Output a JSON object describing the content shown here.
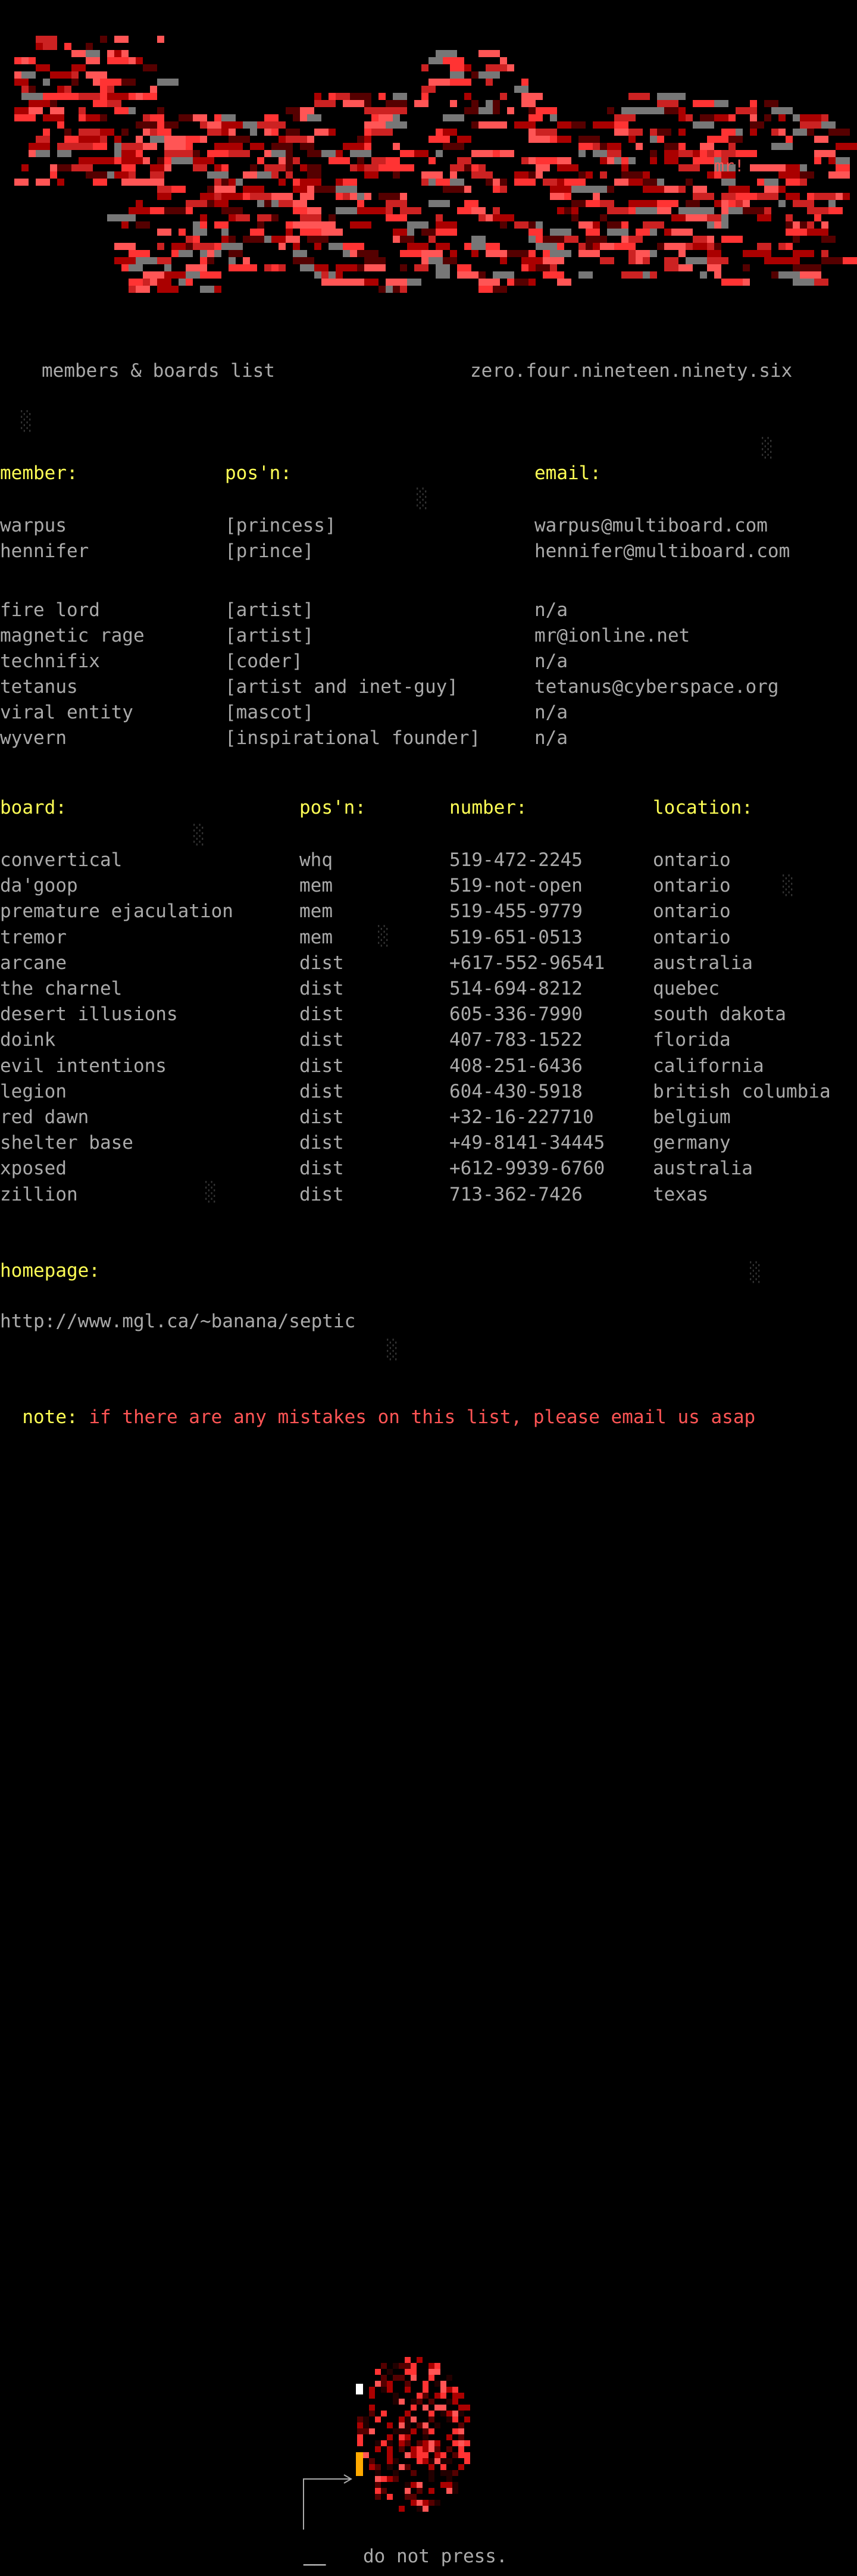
{
  "header": {
    "logo_tag": "mr!",
    "subtitle_left": "members & boards list",
    "subtitle_right": "zero.four.nineteen.ninety.six"
  },
  "members": {
    "headers": {
      "member": "member:",
      "pos": "pos'n:",
      "email": "email:"
    },
    "rows": [
      {
        "member": "warpus",
        "pos": "[princess]",
        "email": "warpus@multiboard.com"
      },
      {
        "member": "hennifer",
        "pos": "[prince]",
        "email": "hennifer@multiboard.com"
      },
      {
        "member": "fire lord",
        "pos": "[artist]",
        "email": "n/a"
      },
      {
        "member": "magnetic rage",
        "pos": "[artist]",
        "email": "mr@ionline.net"
      },
      {
        "member": "technifix",
        "pos": "[coder]",
        "email": "n/a"
      },
      {
        "member": "tetanus",
        "pos": "[artist and inet-guy]",
        "email": "tetanus@cyberspace.org"
      },
      {
        "member": "viral entity",
        "pos": "[mascot]",
        "email": "n/a"
      },
      {
        "member": "wyvern",
        "pos": "[inspirational founder]",
        "email": "n/a"
      }
    ]
  },
  "boards": {
    "headers": {
      "board": "board:",
      "pos": "pos'n:",
      "number": "number:",
      "location": "location:"
    },
    "rows": [
      {
        "board": "convertical",
        "pos": "whq",
        "number": "519-472-2245",
        "location": "ontario"
      },
      {
        "board": "da'goop",
        "pos": "mem",
        "number": "519-not-open",
        "location": "ontario"
      },
      {
        "board": "premature ejaculation",
        "pos": "mem",
        "number": "519-455-9779",
        "location": "ontario"
      },
      {
        "board": "tremor",
        "pos": "mem",
        "number": "519-651-0513",
        "location": "ontario"
      },
      {
        "board": "arcane",
        "pos": "dist",
        "number": "+617-552-96541",
        "location": "australia"
      },
      {
        "board": "the charnel",
        "pos": "dist",
        "number": "514-694-8212",
        "location": "quebec"
      },
      {
        "board": "desert illusions",
        "pos": "dist",
        "number": "605-336-7990",
        "location": "south dakota"
      },
      {
        "board": "doink",
        "pos": "dist",
        "number": "407-783-1522",
        "location": "florida"
      },
      {
        "board": "evil intentions",
        "pos": "dist",
        "number": "408-251-6436",
        "location": "california"
      },
      {
        "board": "legion",
        "pos": "dist",
        "number": "604-430-5918",
        "location": "british columbia"
      },
      {
        "board": "red dawn",
        "pos": "dist",
        "number": "+32-16-227710",
        "location": "belgium"
      },
      {
        "board": "shelter base",
        "pos": "dist",
        "number": "+49-8141-34445",
        "location": "germany"
      },
      {
        "board": "xposed",
        "pos": "dist",
        "number": "+612-9939-6760",
        "location": "australia"
      },
      {
        "board": "zillion",
        "pos": "dist",
        "number": "713-362-7426",
        "location": "texas"
      }
    ]
  },
  "homepage": {
    "label": "homepage:",
    "url": "http://www.mgl.ca/~banana/septic"
  },
  "note": {
    "label": "note:",
    "text": "if there are any mistakes on this list, please email us asap"
  },
  "footer": {
    "caption": "do not press."
  },
  "colors": {
    "heading": "#ffff55",
    "text": "#aaaaaa",
    "accent": "#ff5555",
    "dark_red": "#aa0000"
  }
}
